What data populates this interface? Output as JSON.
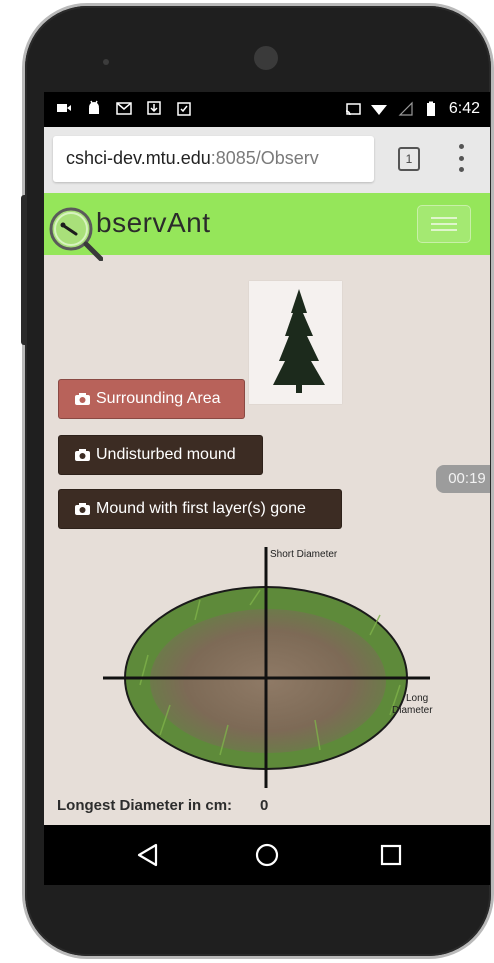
{
  "status_bar": {
    "time": "6:42",
    "left_icons": [
      "video-icon",
      "android-icon",
      "gmail-icon",
      "download-icon",
      "clipboard-check-icon"
    ],
    "right_icons": [
      "cast-icon",
      "wifi-icon",
      "signal-icon",
      "battery-icon"
    ]
  },
  "browser": {
    "url_host": "cshci-dev.mtu.edu",
    "url_rest": ":8085/Observ",
    "tab_count": "1"
  },
  "app": {
    "brand_rest": "bservAnt",
    "brand_color": "#95e65a"
  },
  "buttons": {
    "surrounding": "Surrounding Area",
    "undisturbed": "Undisturbed mound",
    "first_layers": "Mound with first layer(s) gone"
  },
  "timer": "00:19",
  "mound_diagram": {
    "short_label": "Short Diameter",
    "long_label_1": "Long",
    "long_label_2": "Diameter"
  },
  "measurement": {
    "label": "Longest Diameter in cm:",
    "value": "0"
  },
  "colors": {
    "surrounding_button": "#b8625a",
    "dark_button": "#3c2c23",
    "page_background": "#e6ded8"
  }
}
